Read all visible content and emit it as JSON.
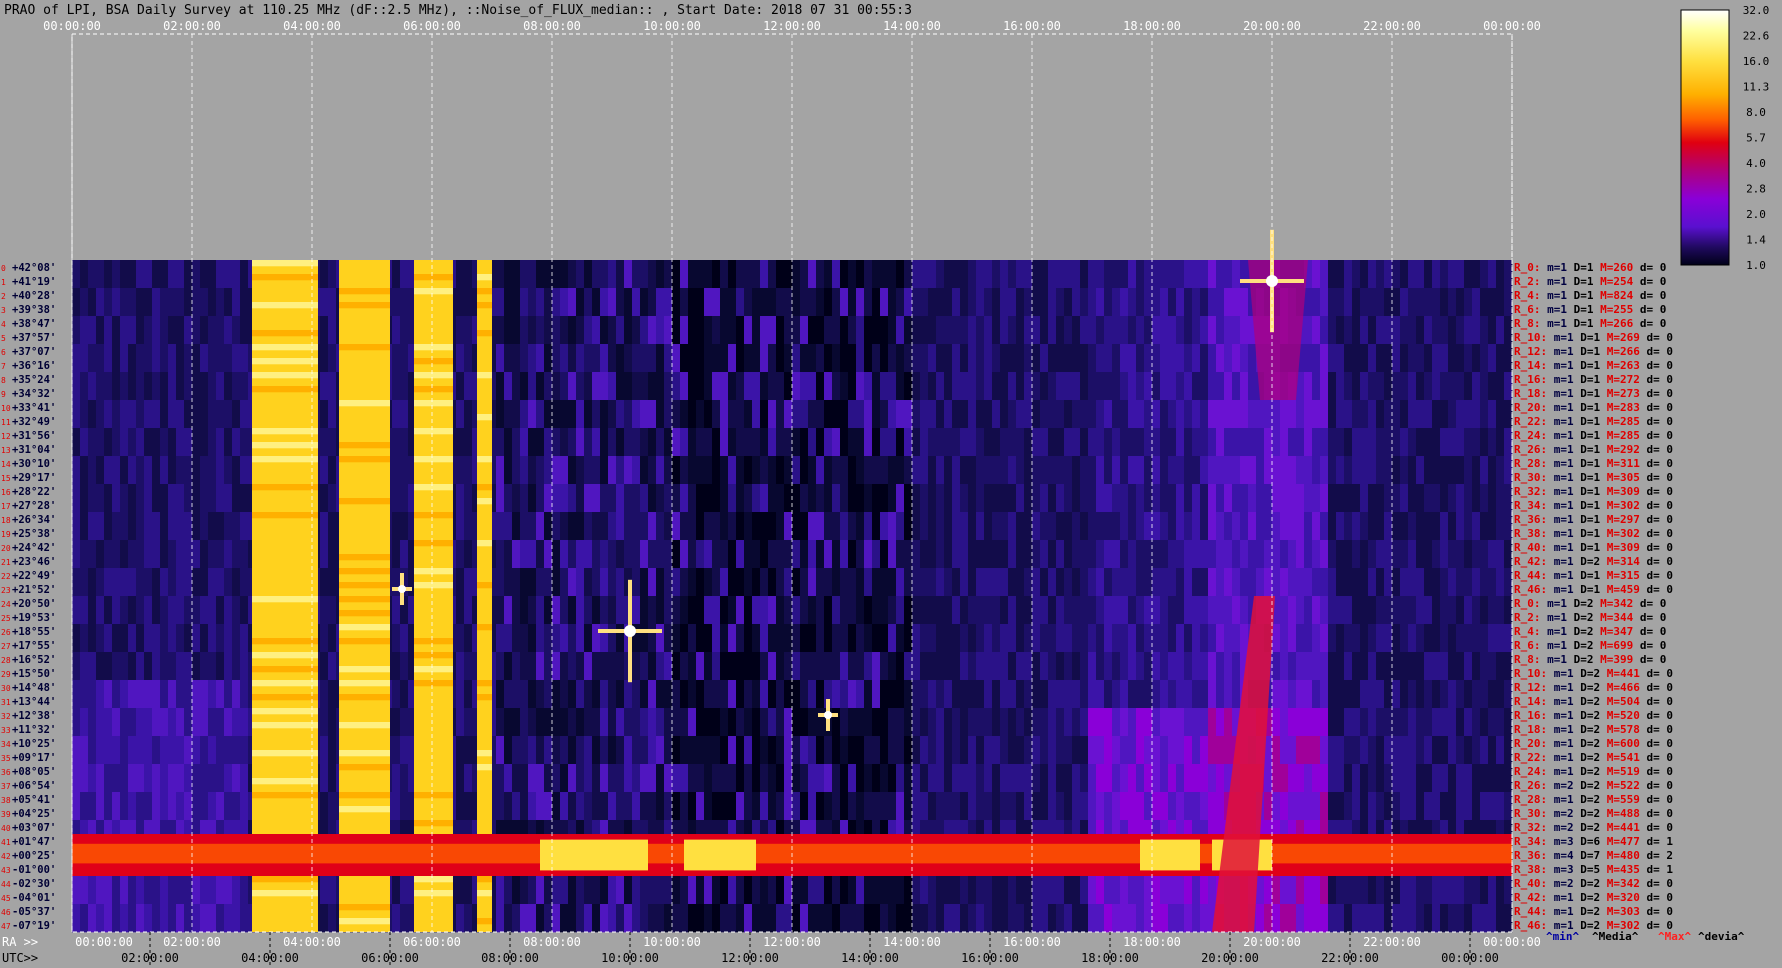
{
  "chart_data": {
    "type": "heatmap",
    "title": "PRAO of LPI, BSA Daily Survey at 110.25 MHz (dF::2.5 MHz), ::Noise_of_FLUX_median:: , Start Date: 2018 07 31 00:55:3",
    "x_axis_top": {
      "ticks": [
        "00:00:00",
        "02:00:00",
        "04:00:00",
        "06:00:00",
        "08:00:00",
        "10:00:00",
        "12:00:00",
        "14:00:00",
        "16:00:00",
        "18:00:00",
        "20:00:00",
        "22:00:00",
        "00:00:00"
      ]
    },
    "x_axis_ra": {
      "label": "RA >>",
      "ticks": [
        "00:00:00",
        "02:00:00",
        "04:00:00",
        "06:00:00",
        "08:00:00",
        "10:00:00",
        "12:00:00",
        "14:00:00",
        "16:00:00",
        "18:00:00",
        "20:00:00",
        "22:00:00",
        "00:00:00"
      ]
    },
    "x_axis_utc": {
      "label": "UTC>>",
      "ticks": [
        "02:00:00",
        "04:00:00",
        "06:00:00",
        "08:00:00",
        "10:00:00",
        "12:00:00",
        "14:00:00",
        "16:00:00",
        "18:00:00",
        "20:00:00",
        "22:00:00",
        "00:00:00"
      ]
    },
    "declinations": [
      "+42°08'",
      "+41°19'",
      "+40°28'",
      "+39°38'",
      "+38°47'",
      "+37°57'",
      "+37°07'",
      "+36°16'",
      "+35°24'",
      "+34°32'",
      "+33°41'",
      "+32°49'",
      "+31°56'",
      "+31°04'",
      "+30°10'",
      "+29°17'",
      "+28°22'",
      "+27°28'",
      "+26°34'",
      "+25°38'",
      "+24°42'",
      "+23°46'",
      "+22°49'",
      "+21°52'",
      "+20°50'",
      "+19°53'",
      "+18°55'",
      "+17°55'",
      "+16°52'",
      "+15°50'",
      "+14°48'",
      "+13°44'",
      "+12°38'",
      "+11°32'",
      "+10°25'",
      "+09°17'",
      "+08°05'",
      "+06°54'",
      "+05°41'",
      "+04°25'",
      "+03°07'",
      "+01°47'",
      "+00°25'",
      "-01°00'",
      "-02°30'",
      "-04°01'",
      "-05°37'",
      "-07°19'"
    ],
    "row_numbers": [
      "0",
      "1",
      "2",
      "3",
      "4",
      "5",
      "6",
      "7",
      "8",
      "9",
      "10",
      "11",
      "12",
      "13",
      "14",
      "15",
      "16",
      "17",
      "18",
      "19",
      "20",
      "21",
      "22",
      "23",
      "24",
      "25",
      "26",
      "27",
      "28",
      "29",
      "30",
      "31",
      "32",
      "33",
      "34",
      "35",
      "36",
      "37",
      "38",
      "39",
      "40",
      "41",
      "42",
      "43",
      "44",
      "45",
      "46",
      "47"
    ],
    "colorbar": {
      "ticks": [
        "32.0",
        "22.6",
        "16.0",
        "11.3",
        "8.0",
        "5.7",
        "4.0",
        "2.8",
        "2.0",
        "1.4",
        "1.0"
      ],
      "colors": [
        "#ffffff",
        "#ffffa0",
        "#ffe040",
        "#ffb000",
        "#ff6000",
        "#e00010",
        "#b0007a",
        "#8a00d8",
        "#5a10d0",
        "#200a60",
        "#000018"
      ]
    },
    "rows": [
      {
        "name": "R_0:",
        "m": "m=1",
        "D": "D=1",
        "M": "M=260",
        "d": "d= 0"
      },
      {
        "name": "R_2:",
        "m": "m=1",
        "D": "D=1",
        "M": "M=254",
        "d": "d= 0"
      },
      {
        "name": "R_4:",
        "m": "m=1",
        "D": "D=1",
        "M": "M=824",
        "d": "d= 0"
      },
      {
        "name": "R_6:",
        "m": "m=1",
        "D": "D=1",
        "M": "M=255",
        "d": "d= 0"
      },
      {
        "name": "R_8:",
        "m": "m=1",
        "D": "D=1",
        "M": "M=266",
        "d": "d= 0"
      },
      {
        "name": "R_10:",
        "m": "m=1",
        "D": "D=1",
        "M": "M=269",
        "d": "d= 0"
      },
      {
        "name": "R_12:",
        "m": "m=1",
        "D": "D=1",
        "M": "M=266",
        "d": "d= 0"
      },
      {
        "name": "R_14:",
        "m": "m=1",
        "D": "D=1",
        "M": "M=263",
        "d": "d= 0"
      },
      {
        "name": "R_16:",
        "m": "m=1",
        "D": "D=1",
        "M": "M=272",
        "d": "d= 0"
      },
      {
        "name": "R_18:",
        "m": "m=1",
        "D": "D=1",
        "M": "M=273",
        "d": "d= 0"
      },
      {
        "name": "R_20:",
        "m": "m=1",
        "D": "D=1",
        "M": "M=283",
        "d": "d= 0"
      },
      {
        "name": "R_22:",
        "m": "m=1",
        "D": "D=1",
        "M": "M=285",
        "d": "d= 0"
      },
      {
        "name": "R_24:",
        "m": "m=1",
        "D": "D=1",
        "M": "M=285",
        "d": "d= 0"
      },
      {
        "name": "R_26:",
        "m": "m=1",
        "D": "D=1",
        "M": "M=292",
        "d": "d= 0"
      },
      {
        "name": "R_28:",
        "m": "m=1",
        "D": "D=1",
        "M": "M=311",
        "d": "d= 0"
      },
      {
        "name": "R_30:",
        "m": "m=1",
        "D": "D=1",
        "M": "M=305",
        "d": "d= 0"
      },
      {
        "name": "R_32:",
        "m": "m=1",
        "D": "D=1",
        "M": "M=309",
        "d": "d= 0"
      },
      {
        "name": "R_34:",
        "m": "m=1",
        "D": "D=1",
        "M": "M=302",
        "d": "d= 0"
      },
      {
        "name": "R_36:",
        "m": "m=1",
        "D": "D=1",
        "M": "M=297",
        "d": "d= 0"
      },
      {
        "name": "R_38:",
        "m": "m=1",
        "D": "D=1",
        "M": "M=302",
        "d": "d= 0"
      },
      {
        "name": "R_40:",
        "m": "m=1",
        "D": "D=1",
        "M": "M=309",
        "d": "d= 0"
      },
      {
        "name": "R_42:",
        "m": "m=1",
        "D": "D=2",
        "M": "M=314",
        "d": "d= 0"
      },
      {
        "name": "R_44:",
        "m": "m=1",
        "D": "D=1",
        "M": "M=315",
        "d": "d= 0"
      },
      {
        "name": "R_46:",
        "m": "m=1",
        "D": "D=1",
        "M": "M=459",
        "d": "d= 0"
      },
      {
        "name": "R_0:",
        "m": "m=1",
        "D": "D=2",
        "M": "M=342",
        "d": "d= 0"
      },
      {
        "name": "R_2:",
        "m": "m=1",
        "D": "D=2",
        "M": "M=344",
        "d": "d= 0"
      },
      {
        "name": "R_4:",
        "m": "m=1",
        "D": "D=2",
        "M": "M=347",
        "d": "d= 0"
      },
      {
        "name": "R_6:",
        "m": "m=1",
        "D": "D=2",
        "M": "M=699",
        "d": "d= 0"
      },
      {
        "name": "R_8:",
        "m": "m=1",
        "D": "D=2",
        "M": "M=399",
        "d": "d= 0"
      },
      {
        "name": "R_10:",
        "m": "m=1",
        "D": "D=2",
        "M": "M=441",
        "d": "d= 0"
      },
      {
        "name": "R_12:",
        "m": "m=1",
        "D": "D=2",
        "M": "M=466",
        "d": "d= 0"
      },
      {
        "name": "R_14:",
        "m": "m=1",
        "D": "D=2",
        "M": "M=504",
        "d": "d= 0"
      },
      {
        "name": "R_16:",
        "m": "m=1",
        "D": "D=2",
        "M": "M=520",
        "d": "d= 0"
      },
      {
        "name": "R_18:",
        "m": "m=1",
        "D": "D=2",
        "M": "M=578",
        "d": "d= 0"
      },
      {
        "name": "R_20:",
        "m": "m=1",
        "D": "D=2",
        "M": "M=600",
        "d": "d= 0"
      },
      {
        "name": "R_22:",
        "m": "m=1",
        "D": "D=2",
        "M": "M=541",
        "d": "d= 0"
      },
      {
        "name": "R_24:",
        "m": "m=1",
        "D": "D=2",
        "M": "M=519",
        "d": "d= 0"
      },
      {
        "name": "R_26:",
        "m": "m=2",
        "D": "D=2",
        "M": "M=522",
        "d": "d= 0"
      },
      {
        "name": "R_28:",
        "m": "m=1",
        "D": "D=2",
        "M": "M=559",
        "d": "d= 0"
      },
      {
        "name": "R_30:",
        "m": "m=2",
        "D": "D=2",
        "M": "M=488",
        "d": "d= 0"
      },
      {
        "name": "R_32:",
        "m": "m=2",
        "D": "D=2",
        "M": "M=441",
        "d": "d= 0"
      },
      {
        "name": "R_34:",
        "m": "m=3",
        "D": "D=6",
        "M": "M=477",
        "d": "d= 1"
      },
      {
        "name": "R_36:",
        "m": "m=4",
        "D": "D=7",
        "M": "M=480",
        "d": "d= 2"
      },
      {
        "name": "R_38:",
        "m": "m=3",
        "D": "D=5",
        "M": "M=435",
        "d": "d= 1"
      },
      {
        "name": "R_40:",
        "m": "m=2",
        "D": "D=2",
        "M": "M=342",
        "d": "d= 0"
      },
      {
        "name": "R_42:",
        "m": "m=1",
        "D": "D=2",
        "M": "M=320",
        "d": "d= 0"
      },
      {
        "name": "R_44:",
        "m": "m=1",
        "D": "D=2",
        "M": "M=303",
        "d": "d= 0"
      },
      {
        "name": "R_46:",
        "m": "m=1",
        "D": "D=2",
        "M": "M=302",
        "d": "d= 0"
      }
    ],
    "legend": {
      "min": "^min^",
      "median": "^Media^",
      "max": "^Max^",
      "devia": "^devia^"
    },
    "sources": [
      {
        "ra_hours": 20.0,
        "dec_row": 1,
        "intensity": "32.0"
      },
      {
        "ra_hours": 9.3,
        "dec_row": 26,
        "intensity": "32.0"
      },
      {
        "ra_hours": 5.5,
        "dec_row": 23,
        "intensity": "22.6"
      },
      {
        "ra_hours": 12.6,
        "dec_row": 32,
        "intensity": "22.6"
      }
    ],
    "bright_bands_ra_hours": [
      [
        3.0,
        4.1
      ],
      [
        4.45,
        5.3
      ],
      [
        5.7,
        6.35
      ],
      [
        6.75,
        7.0
      ]
    ],
    "galactic_band_dec_rows": [
      41,
      43
    ],
    "grid": true
  }
}
